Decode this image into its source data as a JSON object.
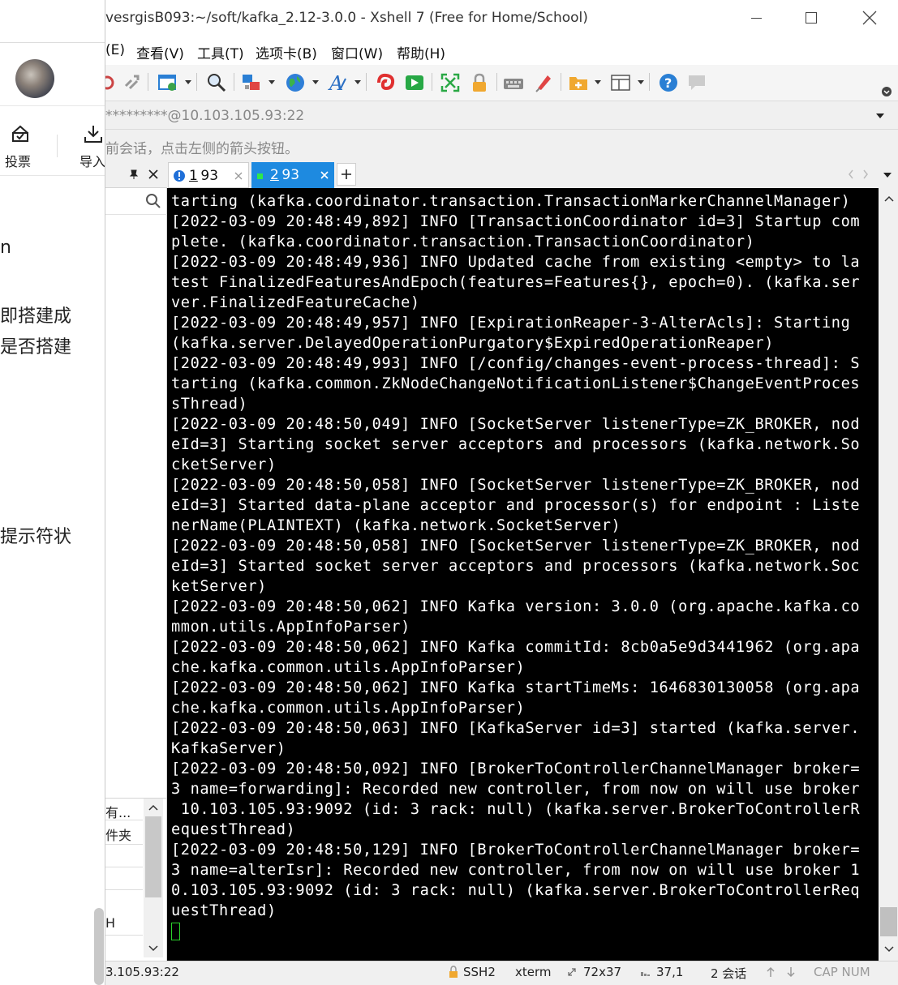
{
  "left": {
    "vote_label": "投票",
    "import_label": "导入",
    "frag1": "n",
    "frag2": "即搭建成",
    "frag3": "是否搭建",
    "frag4": "提示符状",
    "list_items": [
      "有...",
      "件夹",
      "",
      "",
      "H",
      ""
    ],
    "status_ip": "3.105.93:22"
  },
  "window": {
    "title": "vesrgisB093:~/soft/kafka_2.12-3.0.0 - Xshell 7 (Free for Home/School)"
  },
  "menu": [
    "(E)",
    "查看(V)",
    "工具(T)",
    "选项卡(B)",
    "窗口(W)",
    "帮助(H)"
  ],
  "toolbar_icons": [
    "disconnect-icon",
    "reconnect-icon",
    "properties-icon",
    "find-icon",
    "transfer-icon",
    "globe-icon",
    "font-icon",
    "xftp-icon",
    "xdrive-icon",
    "fullscreen-icon",
    "lock-icon",
    "keyboard-icon",
    "highlight-icon",
    "new-tab-icon",
    "layout-icon",
    "help-icon",
    "chat-icon"
  ],
  "address": {
    "value": "*********@10.103.105.93:22"
  },
  "hint": "前会话，点击左侧的箭头按钮。",
  "tabs": [
    {
      "num": "1",
      "label": " 93",
      "active": false
    },
    {
      "num": "2",
      "label": " 93",
      "active": true
    }
  ],
  "terminal": {
    "lines": [
      "tarting (kafka.coordinator.transaction.TransactionMarkerChannelManager)",
      "[2022-03-09 20:48:49,892] INFO [TransactionCoordinator id=3] Startup com",
      "plete. (kafka.coordinator.transaction.TransactionCoordinator)",
      "[2022-03-09 20:48:49,936] INFO Updated cache from existing <empty> to la",
      "test FinalizedFeaturesAndEpoch(features=Features{}, epoch=0). (kafka.ser",
      "ver.FinalizedFeatureCache)",
      "[2022-03-09 20:48:49,957] INFO [ExpirationReaper-3-AlterAcls]: Starting",
      "(kafka.server.DelayedOperationPurgatory$ExpiredOperationReaper)",
      "[2022-03-09 20:48:49,993] INFO [/config/changes-event-process-thread]: S",
      "tarting (kafka.common.ZkNodeChangeNotificationListener$ChangeEventProces",
      "sThread)",
      "[2022-03-09 20:48:50,049] INFO [SocketServer listenerType=ZK_BROKER, nod",
      "eId=3] Starting socket server acceptors and processors (kafka.network.So",
      "cketServer)",
      "[2022-03-09 20:48:50,058] INFO [SocketServer listenerType=ZK_BROKER, nod",
      "eId=3] Started data-plane acceptor and processor(s) for endpoint : Liste",
      "nerName(PLAINTEXT) (kafka.network.SocketServer)",
      "[2022-03-09 20:48:50,058] INFO [SocketServer listenerType=ZK_BROKER, nod",
      "eId=3] Started socket server acceptors and processors (kafka.network.Soc",
      "ketServer)",
      "[2022-03-09 20:48:50,062] INFO Kafka version: 3.0.0 (org.apache.kafka.co",
      "mmon.utils.AppInfoParser)",
      "[2022-03-09 20:48:50,062] INFO Kafka commitId: 8cb0a5e9d3441962 (org.apa",
      "che.kafka.common.utils.AppInfoParser)",
      "[2022-03-09 20:48:50,062] INFO Kafka startTimeMs: 1646830130058 (org.apa",
      "che.kafka.common.utils.AppInfoParser)",
      "[2022-03-09 20:48:50,063] INFO [KafkaServer id=3] started (kafka.server.",
      "KafkaServer)",
      "[2022-03-09 20:48:50,092] INFO [BrokerToControllerChannelManager broker=",
      "3 name=forwarding]: Recorded new controller, from now on will use broker",
      " 10.103.105.93:9092 (id: 3 rack: null) (kafka.server.BrokerToControllerR",
      "equestThread)",
      "[2022-03-09 20:48:50,129] INFO [BrokerToControllerChannelManager broker=",
      "3 name=alterIsr]: Recorded new controller, from now on will use broker 1",
      "0.103.105.93:9092 (id: 3 rack: null) (kafka.server.BrokerToControllerReq",
      "uestThread)"
    ]
  },
  "statusbar": {
    "protocol": "SSH2",
    "term": "xterm",
    "size": "72x37",
    "cursor": "37,1",
    "sessions": "2 会话",
    "keys": "CAP NUM"
  }
}
